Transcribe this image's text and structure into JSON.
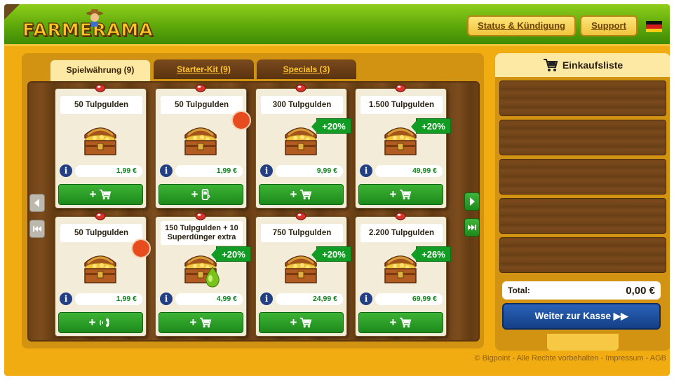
{
  "header": {
    "logo_text": "FARMERAMA",
    "status_button": "Status & Kündigung",
    "support_button": "Support",
    "language_flag": "german-flag-icon"
  },
  "tabs": [
    {
      "label": "Spielwährung (9)",
      "active": true
    },
    {
      "label": "Starter-Kit (9)",
      "active": false
    },
    {
      "label": "Specials (3)",
      "active": false
    }
  ],
  "products": [
    {
      "name": "50 Tulpgulden",
      "price": "1,99 €",
      "bonus": "",
      "payment": "cart-icon"
    },
    {
      "name": "50 Tulpgulden",
      "price": "1,99 €",
      "bonus": "",
      "payment": "mobile-phone-icon"
    },
    {
      "name": "300 Tulpgulden",
      "price": "9,99 €",
      "bonus": "+20%",
      "payment": "cart-icon"
    },
    {
      "name": "1.500 Tulpgulden",
      "price": "49,99 €",
      "bonus": "+20%",
      "payment": "cart-icon"
    },
    {
      "name": "50 Tulpgulden",
      "price": "1,99 €",
      "bonus": "",
      "payment": "telephone-icon"
    },
    {
      "name": "150 Tulpgulden + 10 Superdünger extra",
      "price": "4,99 €",
      "bonus": "+20%",
      "payment": "cart-icon"
    },
    {
      "name": "750 Tulpgulden",
      "price": "24,99 €",
      "bonus": "+20%",
      "payment": "cart-icon"
    },
    {
      "name": "2.200 Tulpgulden",
      "price": "69,99 €",
      "bonus": "+26%",
      "payment": "cart-icon"
    }
  ],
  "cart": {
    "title": "Einkaufsliste",
    "total_label": "Total:",
    "total_value": "0,00 €",
    "checkout_label": "Weiter zur Kasse ▶▶"
  },
  "footer": {
    "text": "© Bigpoint - Alle Rechte vorbehalten - Impressum - AGB"
  },
  "colors": {
    "header_green": "#5ea80a",
    "panel_gold": "#f1ac12",
    "buy_green": "#1d8a1c",
    "price_green": "#14821f",
    "checkout_blue": "#143f86"
  }
}
